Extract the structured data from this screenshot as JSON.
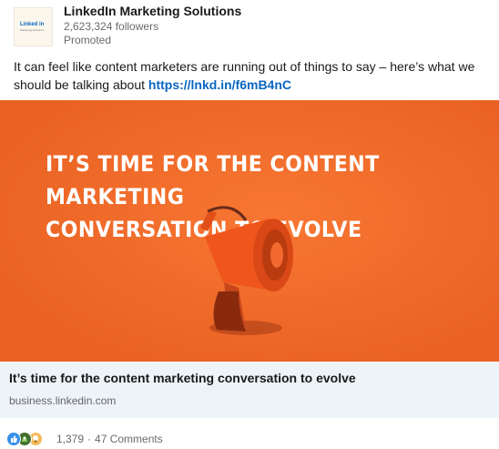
{
  "post": {
    "author": "LinkedIn Marketing Solutions",
    "followers": "2,623,324 followers",
    "promoted": "Promoted",
    "logo_text": "Linked in",
    "logo_sub": "Marketing Solutions",
    "text": "It can feel like content marketers are running out of things to say – here’s what we should be talking about",
    "link": "https://lnkd.in/f6mB4nC"
  },
  "hero": {
    "line1": "IT’S TIME FOR THE CONTENT MARKETING",
    "line2": "CONVERSATION TO EVOLVE",
    "icon": "megaphone-icon",
    "background": "#f46b28"
  },
  "link_card": {
    "title": "It’s time for the content marketing conversation to evolve",
    "domain": "business.linkedin.com"
  },
  "social": {
    "reactions": [
      "like-icon",
      "celebrate-icon",
      "insightful-icon"
    ],
    "reaction_count": "1,379",
    "separator": "·",
    "comments": "47 Comments"
  }
}
